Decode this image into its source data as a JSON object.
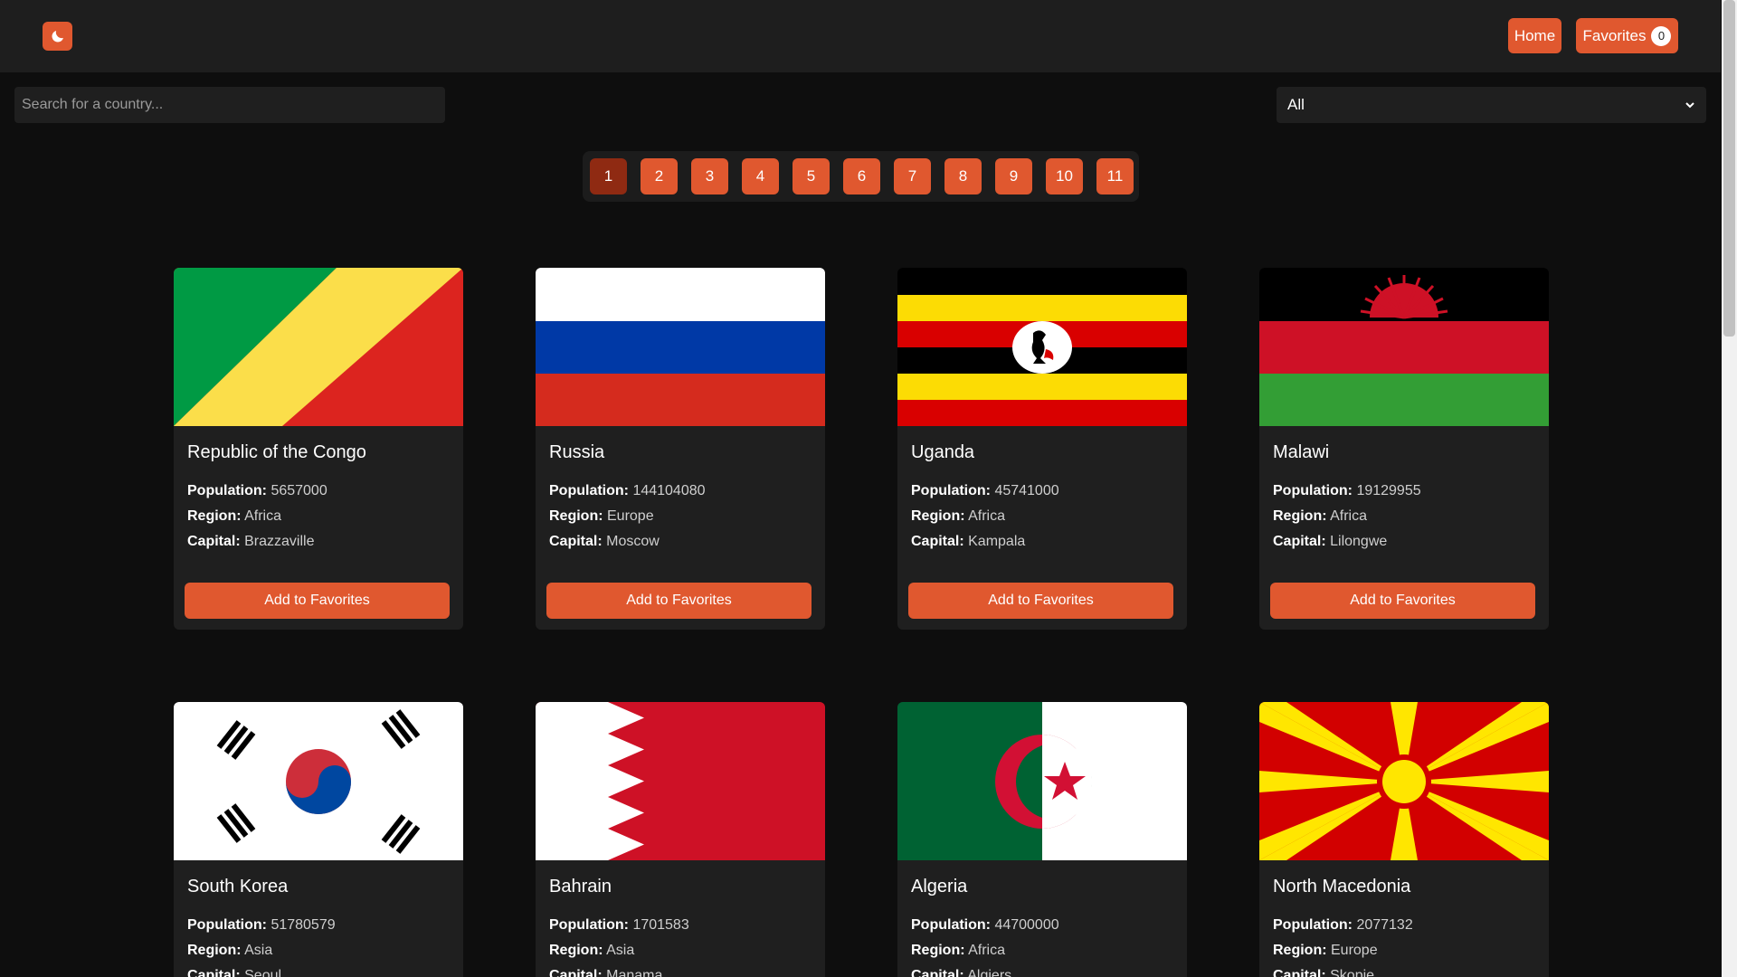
{
  "header": {
    "theme_toggle_icon": "moon-icon",
    "home_label": "Home",
    "favorites_label": "Favorites",
    "favorites_count": "0",
    "accent_color": "#e0582f"
  },
  "search": {
    "placeholder": "Search for a country..."
  },
  "filter": {
    "selected": "All"
  },
  "pagination": {
    "pages": [
      "1",
      "2",
      "3",
      "4",
      "5",
      "6",
      "7",
      "8",
      "9",
      "10",
      "11"
    ],
    "active": "1"
  },
  "labels": {
    "population": "Population:",
    "region": "Region:",
    "capital": "Capital:",
    "add_button": "Add to Favorites"
  },
  "countries": [
    {
      "name": "Republic of the Congo",
      "population": "5657000",
      "region": "Africa",
      "capital": "Brazzaville"
    },
    {
      "name": "Russia",
      "population": "144104080",
      "region": "Europe",
      "capital": "Moscow"
    },
    {
      "name": "Uganda",
      "population": "45741000",
      "region": "Africa",
      "capital": "Kampala"
    },
    {
      "name": "Malawi",
      "population": "19129955",
      "region": "Africa",
      "capital": "Lilongwe"
    },
    {
      "name": "South Korea",
      "population": "51780579",
      "region": "Asia",
      "capital": "Seoul"
    },
    {
      "name": "Bahrain",
      "population": "1701583",
      "region": "Asia",
      "capital": "Manama"
    },
    {
      "name": "Algeria",
      "population": "44700000",
      "region": "Africa",
      "capital": "Algiers"
    },
    {
      "name": "North Macedonia",
      "population": "2077132",
      "region": "Europe",
      "capital": "Skopje"
    }
  ]
}
